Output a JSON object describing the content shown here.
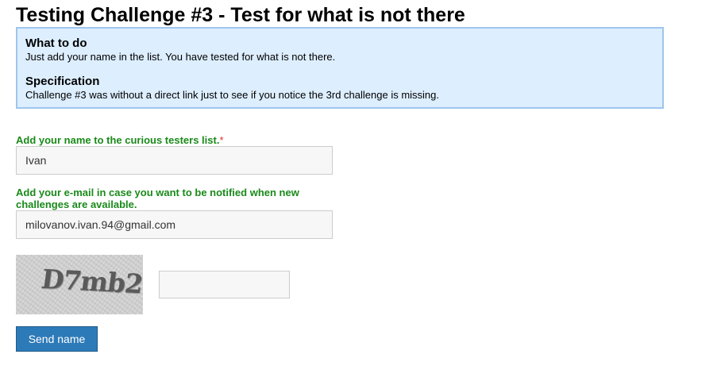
{
  "page": {
    "title": "Testing Challenge #3 - Test for what is not there"
  },
  "info": {
    "what_heading": "What to do",
    "what_text": "Just add your name in the list. You have tested for what is not there.",
    "spec_heading": "Specification",
    "spec_text": "Challenge #3 was without a direct link just to see if you notice the 3rd challenge is missing."
  },
  "form": {
    "name_label": "Add your name to the curious testers list.",
    "required_marker": "*",
    "name_value": "Ivan",
    "email_label": "Add your e-mail in case you want to be notified when new challenges are available.",
    "email_value": "milovanov.ivan.94@gmail.com",
    "captcha_text": "D7mb2",
    "captcha_value": "",
    "send_label": "Send name"
  },
  "colors": {
    "label_green": "#1a8a1a",
    "required_red": "#e03030",
    "info_bg": "#ddeeff",
    "info_border": "#9ec6ee",
    "button_blue": "#2d7ab8"
  }
}
